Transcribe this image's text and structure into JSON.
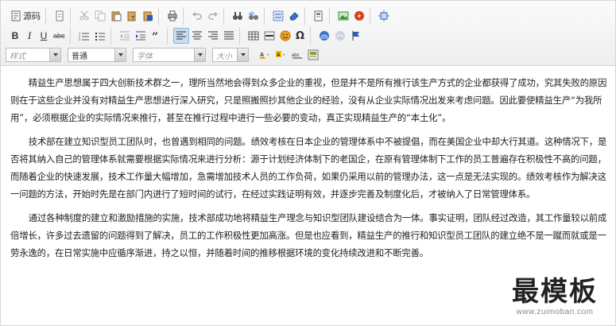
{
  "toolbar": {
    "source_label": "源码",
    "style_combo": "样式",
    "format_combo": "普通",
    "font_combo": "字体",
    "size_combo": "大小",
    "bold_label": "B",
    "italic_label": "I",
    "underline_label": "U",
    "strike_label": "abc",
    "colors": {
      "accent_active": "#c8dcf3",
      "image_icon": "#3a8f3a",
      "flash_icon": "#d9401c",
      "text_color": "#d7a100",
      "bg_color": "#f2c200"
    }
  },
  "content": {
    "paragraphs": [
      "精益生产思想属于四大创新技术群之一，理所当然地会得到众多企业的重视，但是并不是所有推行该生产方式的企业都获得了成功，究其失败的原因则在于这些企业并没有对精益生产思想进行深入研究，只是照搬照抄其他企业的经验，没有从企业实际情况出发来考虑问题。因此要使精益生产“为我所用”，必须根据企业的实际情况来推行，甚至在推行过程中进行一些必要的变动，真正实现精益生产的“本土化”。",
      "技术部在建立知识型员工团队时，也曾遇到相同的问题。绩效考核在日本企业的管理体系中不被提倡，而在美国企业中却大行其道。这种情况下，是否将其纳入自己的管理体系就需要根据实际情况来进行分析：源于计划经济体制下的老国企，在原有管理体制下工作的员工普遍存在积极性不高的问题，而随着企业的快速发展，技术工作量大幅增加，急需增加技术人员的工作负荷，如果仍采用以前的管理办法，这一点是无法实现的。绩效考核作为解决这一问题的方法，开始时先是在部门内进行了短时间的试行，在经过实践证明有效，并逐步完善及制度化后，才被纳入了日常管理体系。",
      "通过各种制度的建立和激励措施的实施，技术部成功地将精益生产理念与知识型团队建设结合为一体。事实证明，团队经过改造，其工作量较以前成倍增长，许多过去遗留的问题得到了解决，员工的工作积极性更加高涨。但是也应看到，精益生产的推行和知识型员工团队的建立绝不是一蹴而就或是一劳永逸的，在日常实施中应循序渐进，持之以恒，并随着时间的推移根据环境的变化持续改进和不断完善。"
    ]
  },
  "watermark": {
    "title": "最模板",
    "url": "www.zuimoban.com"
  }
}
